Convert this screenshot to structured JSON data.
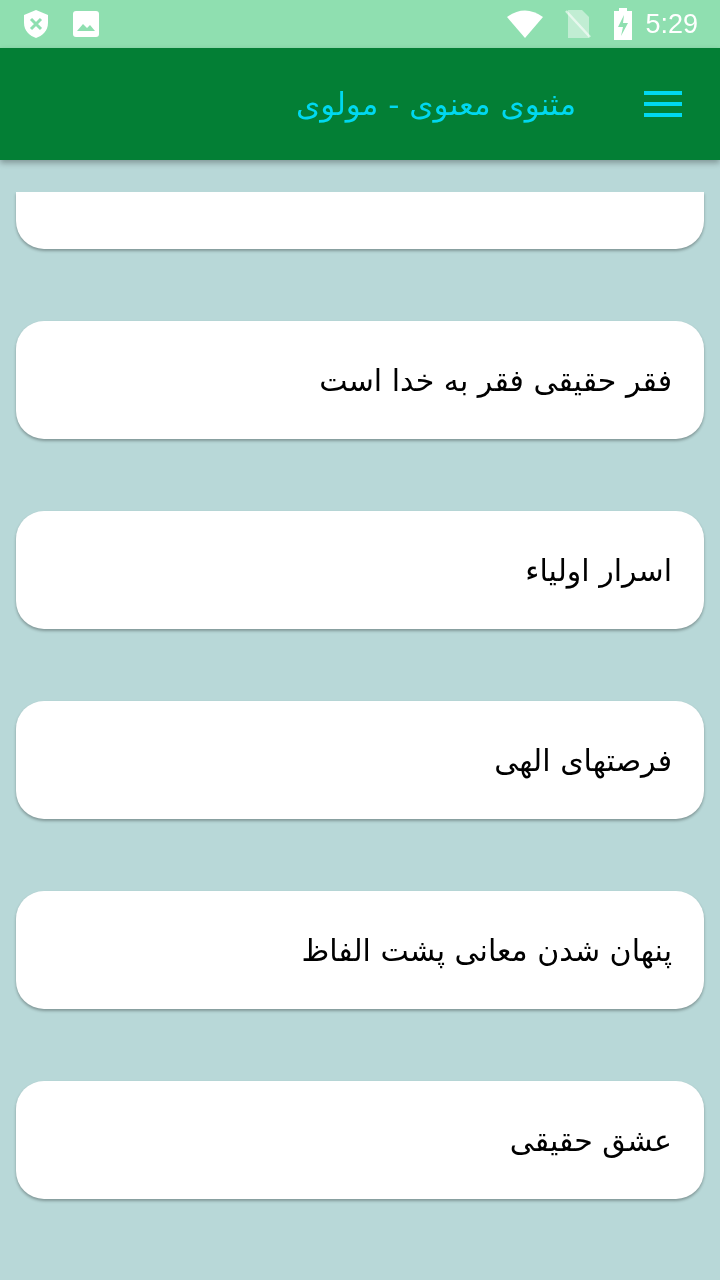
{
  "status_bar": {
    "time": "5:29"
  },
  "app_bar": {
    "title": "مثنوی معنوی - مولوی"
  },
  "items": [
    {
      "title": "فقر حقیقی فقر به خدا است"
    },
    {
      "title": "اسرار اولیاء"
    },
    {
      "title": "فرصتهای الهی"
    },
    {
      "title": "پنهان شدن معانی پشت الفاظ"
    },
    {
      "title": "عشق حقیقی"
    }
  ]
}
